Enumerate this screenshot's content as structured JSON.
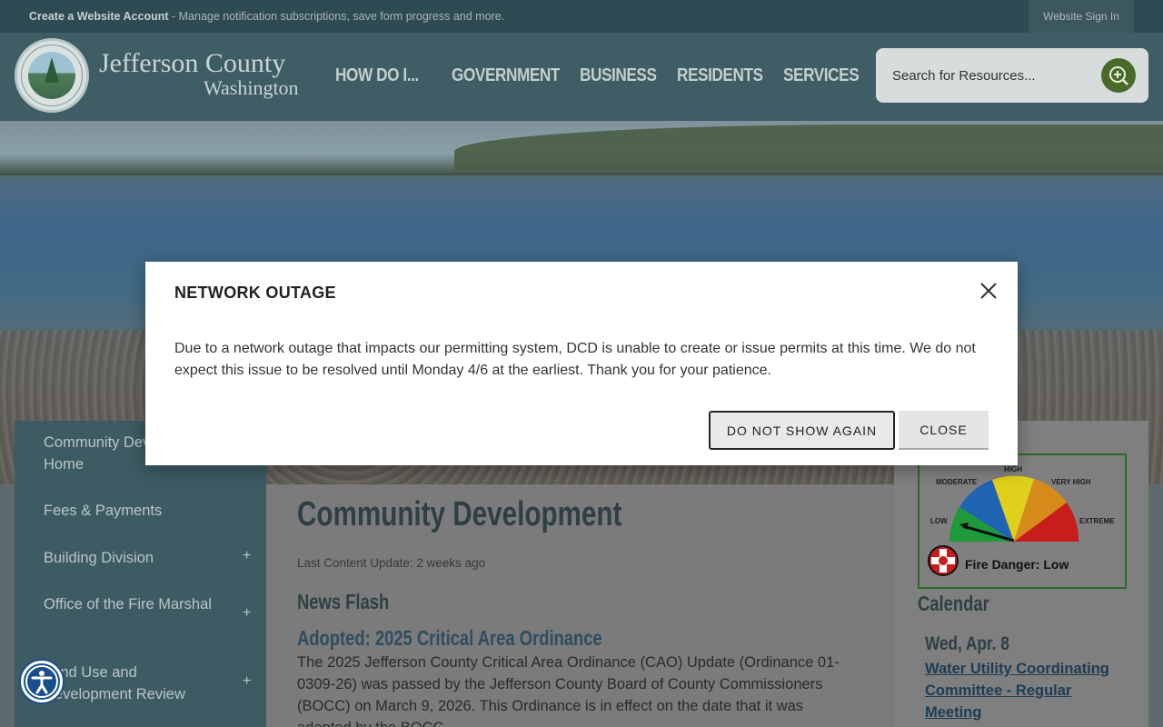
{
  "topbar": {
    "account_link": "Create a Website Account",
    "account_desc": " - Manage notification subscriptions, save form progress and more.",
    "signin": "Website Sign In"
  },
  "header": {
    "brand_line1": "Jefferson County",
    "brand_line2": "Washington",
    "nav": [
      "HOW DO I...",
      "GOVERNMENT",
      "BUSINESS",
      "RESIDENTS",
      "SERVICES"
    ],
    "search_placeholder": "Search for Resources..."
  },
  "sidebar": {
    "items": [
      {
        "label": "Community Development Home",
        "has_children": false
      },
      {
        "label": "Fees & Payments",
        "has_children": false
      },
      {
        "label": "Building Division",
        "has_children": true
      },
      {
        "label": "Office of the Fire Marshal",
        "has_children": true
      },
      {
        "label": "Land Use and Development Review",
        "has_children": true
      }
    ]
  },
  "main": {
    "title": "Community Development",
    "last_update": "Last Content Update: 2 weeks ago",
    "news_heading": "News Flash",
    "news_title": "Adopted: 2025 Critical Area Ordinance",
    "news_body": "The 2025 Jefferson County Critical Area Ordinance (CAO) Update (Ordinance 01-0309-26) was passed by the Jefferson County Board of County Commissioners (BOCC) on March 9, 2026. This Ordinance is in effect on the date that it was adopted by the BOCC."
  },
  "right": {
    "fire_gauge": {
      "labels": [
        "LOW",
        "MODERATE",
        "HIGH",
        "VERY HIGH",
        "EXTREME"
      ],
      "status": "Fire Danger: Low",
      "level": "LOW",
      "colors": {
        "low": "#1f9a3a",
        "moderate": "#1f63b3",
        "high": "#e0cf1b",
        "very_high": "#d68b1a",
        "extreme": "#c91c1c"
      }
    },
    "calendar_heading": "Calendar",
    "event_date": "Wed, Apr. 8",
    "event_title": "Water Utility Coordinating Committee - Regular Meeting"
  },
  "modal": {
    "title": "NETWORK OUTAGE",
    "message": "Due to a network outage that impacts our permitting system, DCD is unable to create or issue permits at this time. We do not expect this issue to be resolved until Monday 4/6 at the earliest. Thank you for your patience.",
    "dont_show_label": "DO NOT SHOW AGAIN",
    "close_label": "CLOSE"
  },
  "colors": {
    "header_bg": "#3e5d65",
    "topbar_bg": "#2e4a52",
    "search_button": "#4a6a2a",
    "accessibility_button": "#1a4f8b"
  }
}
